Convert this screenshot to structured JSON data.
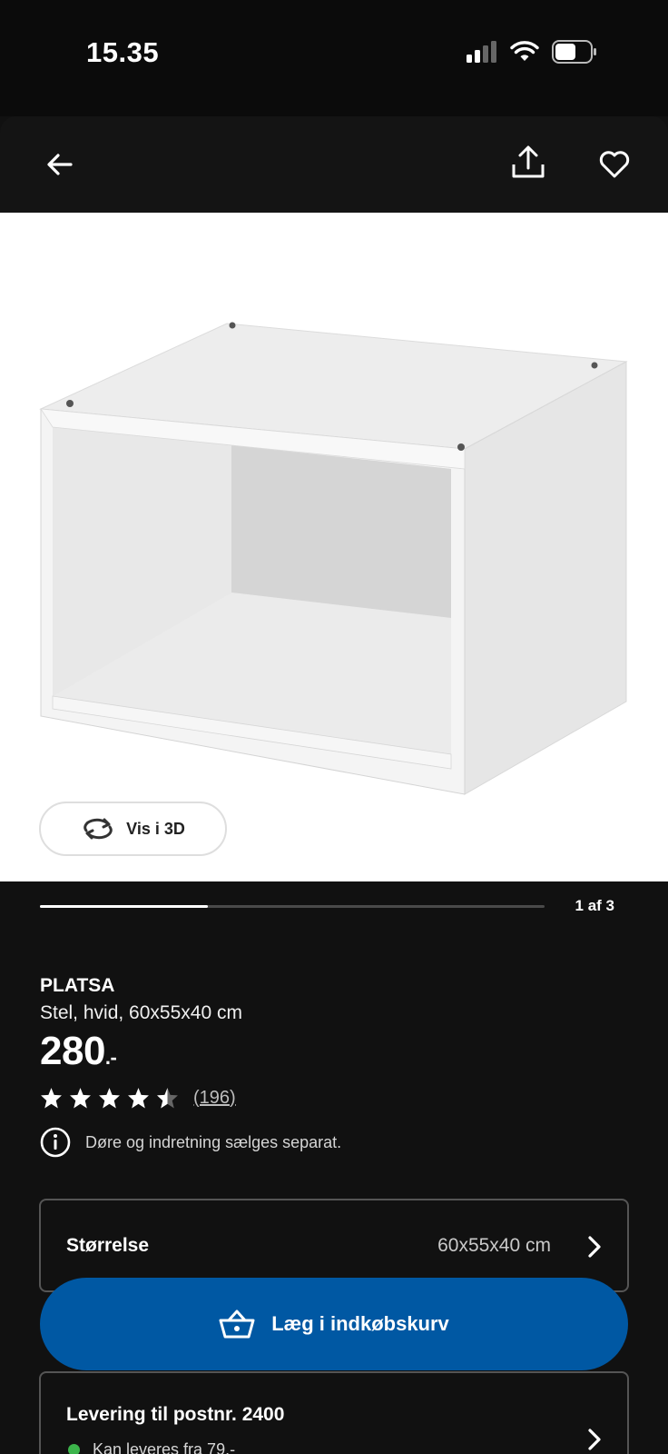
{
  "status_bar": {
    "time": "15.35"
  },
  "image_gallery": {
    "view_3d_label": "Vis i 3D",
    "page_counter": "1 af 3",
    "current_page": 1,
    "total_pages": 3
  },
  "product": {
    "name": "PLATSA",
    "description": "Stel, hvid, 60x55x40 cm",
    "price": "280",
    "price_suffix": ".-",
    "rating": 4.5,
    "review_count": "(196)",
    "info_note": "Døre og indretning sælges separat."
  },
  "size_selector": {
    "label": "Størrelse",
    "value": "60x55x40 cm"
  },
  "cart": {
    "button_label": "Læg i indkøbskurv"
  },
  "delivery": {
    "title": "Levering til postnr. 2400",
    "status": "Kan leveres fra 79.-",
    "status_color": "#3cb44b"
  },
  "colors": {
    "primary_button": "#0058a3",
    "background": "#111111"
  }
}
